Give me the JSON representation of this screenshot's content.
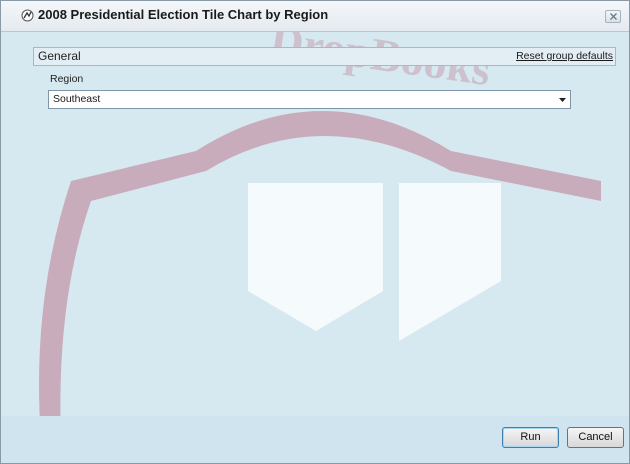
{
  "window": {
    "title": "2008 Presidential Election Tile Chart by Region"
  },
  "group": {
    "title": "General",
    "reset_label": "Reset group defaults"
  },
  "region": {
    "label": "Region",
    "selected": "Southeast"
  },
  "buttons": {
    "run": "Run",
    "cancel": "Cancel"
  },
  "watermark": {
    "text": "DropBooks"
  },
  "icons": {
    "app": "chart-app-icon",
    "close": "close-icon",
    "dropdown": "chevron-down-icon"
  },
  "colors": {
    "dialog_bg": "#d6e9f1",
    "watermark": "#c07a8e"
  }
}
